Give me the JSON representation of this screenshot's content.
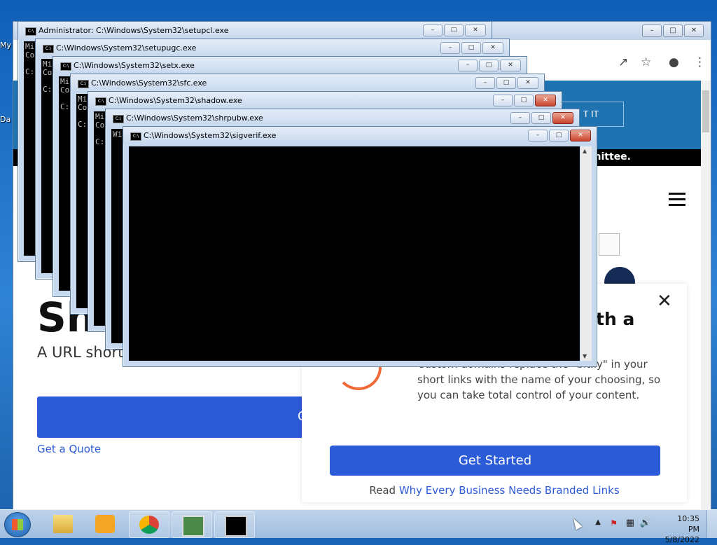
{
  "desktop": {
    "icons": [
      {
        "label": "My"
      },
      {
        "label": "Da"
      }
    ]
  },
  "browser": {
    "banner_button": "T IT",
    "strip_text": "mmittee.",
    "hero": {
      "title": "Sho",
      "subtitle": "A URL short",
      "button_partial": "G",
      "quote_link": "Get a Quote"
    },
    "modal": {
      "heading": "th a",
      "text": "Custom domains replace the \"bit.ly\" in your short links with the name of your choosing, so you can take total control of your content.",
      "cta": "Get Started",
      "read_prefix": "Read",
      "read_link": "Why Every Business Needs Branded Links"
    }
  },
  "cmd_windows": [
    {
      "title": "Administrator: C:\\Windows\\System32\\setupcl.exe",
      "lines": [
        "Mi",
        "Co",
        "",
        "C:"
      ]
    },
    {
      "title": "C:\\Windows\\System32\\setupugc.exe",
      "lines": [
        "Mi",
        "Co",
        "",
        "C:"
      ]
    },
    {
      "title": "C:\\Windows\\System32\\setx.exe",
      "lines": [
        "Mi",
        "Co",
        "",
        "C:"
      ]
    },
    {
      "title": "C:\\Windows\\System32\\sfc.exe",
      "lines": [
        "Mi",
        "Co",
        "",
        "C:"
      ]
    },
    {
      "title": "C:\\Windows\\System32\\shadow.exe",
      "lines": [
        "Mi",
        "Co",
        "",
        "C:"
      ]
    },
    {
      "title": "C:\\Windows\\System32\\shrpubw.exe",
      "lines": [
        "Wi"
      ]
    },
    {
      "title": "C:\\Windows\\System32\\sigverif.exe",
      "lines": []
    }
  ],
  "taskbar": {
    "time": "10:35 PM",
    "date": "5/8/2022"
  }
}
